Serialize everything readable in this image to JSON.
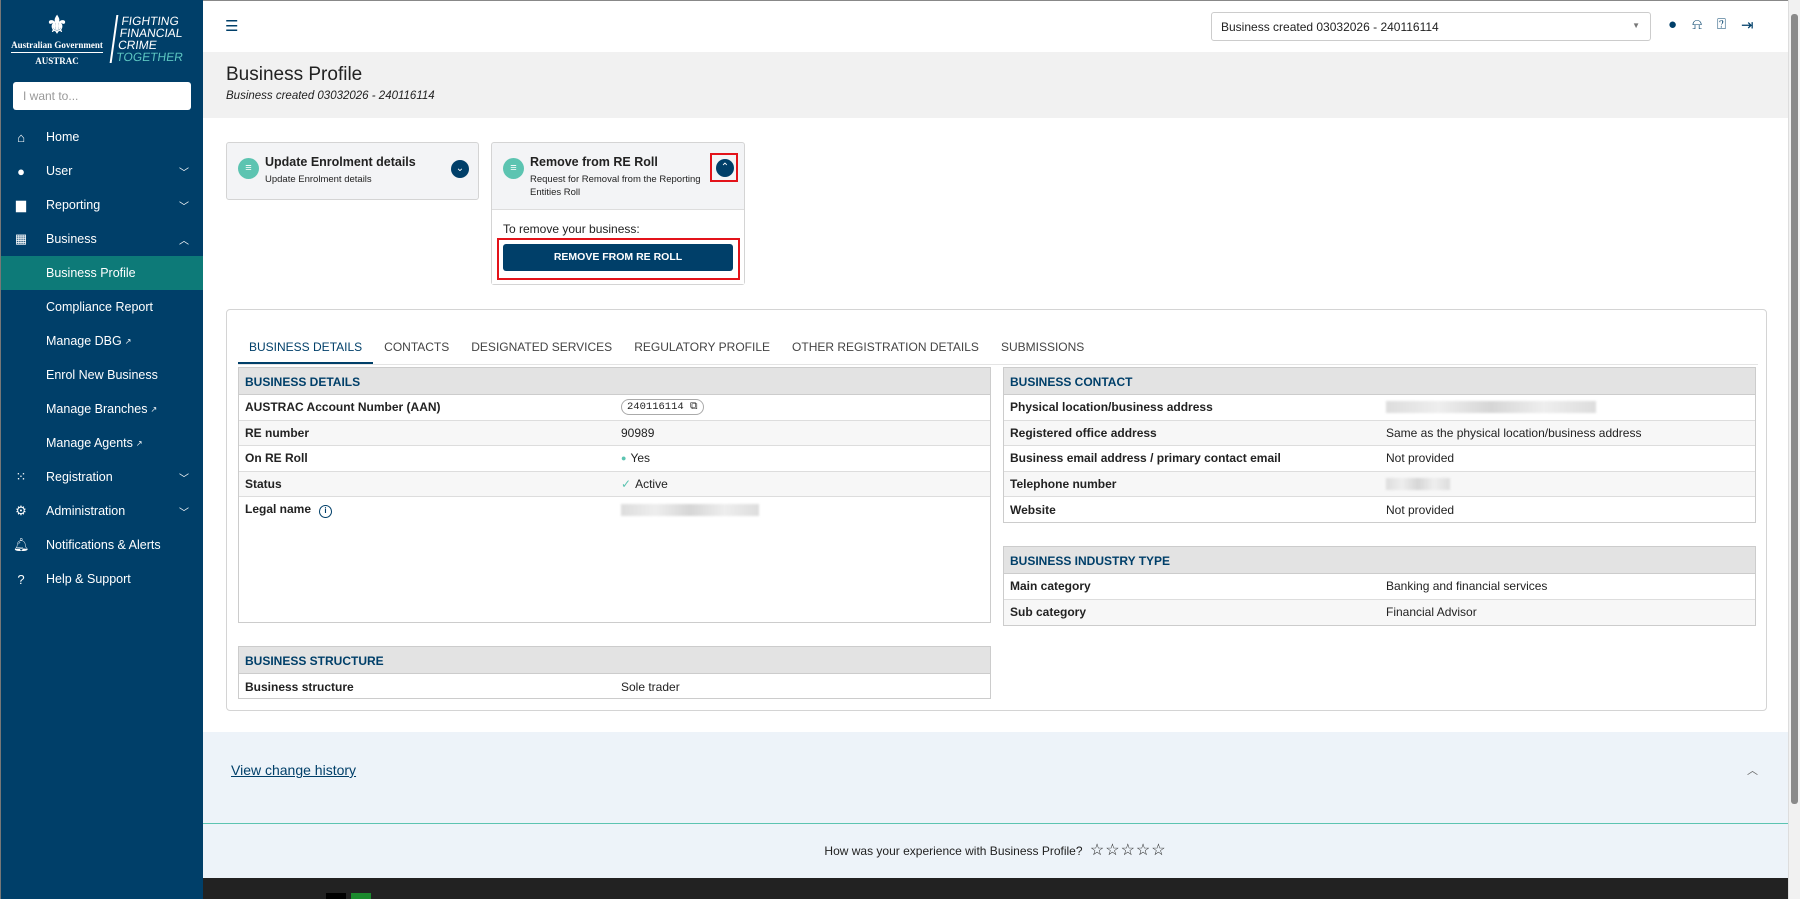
{
  "brand": {
    "gov": "Australian Government",
    "agency": "AUSTRAC",
    "slogan": [
      "FIGHTING",
      "FINANCIAL",
      "CRIME"
    ],
    "slogan_accent": "TOGETHER"
  },
  "search": {
    "placeholder": "I want to..."
  },
  "sidebar": {
    "items": [
      {
        "label": "Home",
        "icon": "home-icon"
      },
      {
        "label": "User",
        "icon": "user-icon"
      },
      {
        "label": "Reporting",
        "icon": "report-icon"
      },
      {
        "label": "Business",
        "icon": "building-icon"
      },
      {
        "label": "Business Profile"
      },
      {
        "label": "Compliance Report"
      },
      {
        "label": "Manage DBG"
      },
      {
        "label": "Enrol New Business"
      },
      {
        "label": "Manage Branches"
      },
      {
        "label": "Manage Agents"
      },
      {
        "label": "Registration",
        "icon": "registration-icon"
      },
      {
        "label": "Administration",
        "icon": "admin-icon"
      },
      {
        "label": "Notifications & Alerts",
        "icon": "bell-icon"
      },
      {
        "label": "Help & Support",
        "icon": "help-icon"
      }
    ]
  },
  "topbar": {
    "business_select": "Business created 03032026 - 240116114"
  },
  "header": {
    "title": "Business Profile",
    "subtitle": "Business created 03032026 - 240116114"
  },
  "cards": {
    "update": {
      "title": "Update Enrolment details",
      "desc": "Update Enrolment details"
    },
    "remove": {
      "title": "Remove from RE Roll",
      "desc": "Request for Removal from the Reporting Entities Roll",
      "body": "To remove your business:",
      "button": "REMOVE FROM RE ROLL"
    }
  },
  "tabs": [
    "BUSINESS DETAILS",
    "CONTACTS",
    "DESIGNATED SERVICES",
    "REGULATORY PROFILE",
    "OTHER REGISTRATION DETAILS",
    "SUBMISSIONS"
  ],
  "business_details": {
    "title": "BUSINESS DETAILS",
    "rows": [
      {
        "k": "AUSTRAC Account Number (AAN)",
        "v": "240116114"
      },
      {
        "k": "RE number",
        "v": "90989"
      },
      {
        "k": "On RE Roll",
        "v": "Yes"
      },
      {
        "k": "Status",
        "v": "Active"
      },
      {
        "k": "Legal name"
      }
    ]
  },
  "business_contact": {
    "title": "BUSINESS CONTACT",
    "rows": [
      {
        "k": "Physical location/business address"
      },
      {
        "k": "Registered office address",
        "v": "Same as the physical location/business address"
      },
      {
        "k": "Business email address / primary contact email",
        "v": "Not provided"
      },
      {
        "k": "Telephone number"
      },
      {
        "k": "Website",
        "v": "Not provided"
      }
    ]
  },
  "industry": {
    "title": "BUSINESS INDUSTRY TYPE",
    "rows": [
      {
        "k": "Main category",
        "v": "Banking and financial services"
      },
      {
        "k": "Sub category",
        "v": "Financial Advisor"
      }
    ]
  },
  "structure": {
    "title": "BUSINESS STRUCTURE",
    "rows": [
      {
        "k": "Business structure",
        "v": "Sole trader"
      }
    ]
  },
  "history": {
    "link": "View change history"
  },
  "rating": {
    "question": "How was your experience with Business Profile?",
    "stars": "☆☆☆☆☆"
  }
}
